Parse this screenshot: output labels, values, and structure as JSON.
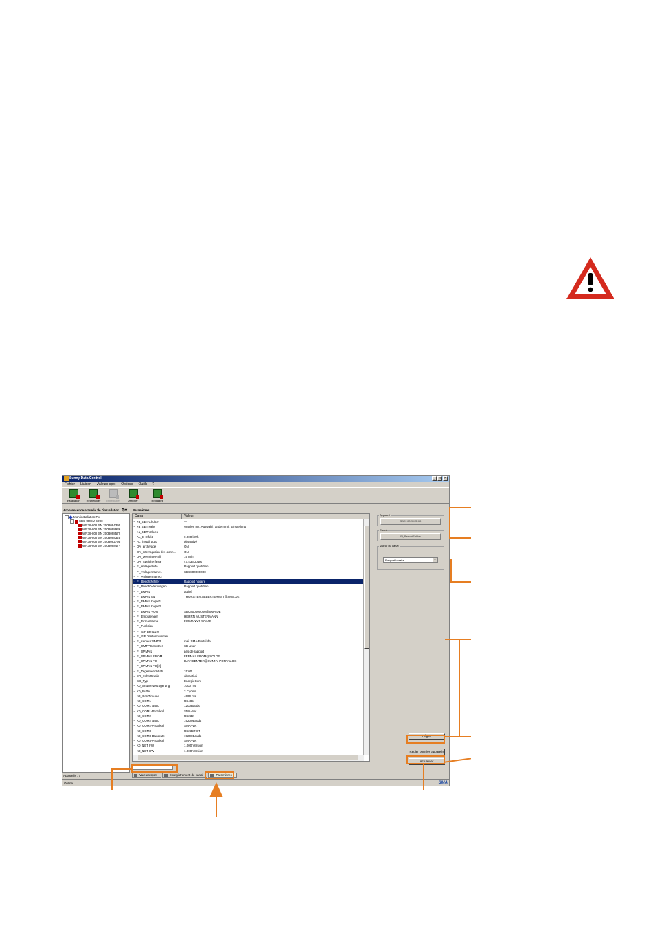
{
  "window": {
    "title": "Sunny Data Control",
    "controls": [
      "_",
      "□",
      "×"
    ]
  },
  "menu": [
    "Fichier",
    "Liaison",
    "Valeurs spot",
    "Options",
    "Outils",
    "?"
  ],
  "toolbar": [
    {
      "label": "Installation",
      "enabled": true
    },
    {
      "label": "Rechercher",
      "enabled": true
    },
    {
      "label": "Enregistrer",
      "enabled": false
    },
    {
      "label": "Afficher",
      "enabled": true
    },
    {
      "label": "Réglages",
      "enabled": true
    }
  ],
  "tree": {
    "header": "Arborescence actuelle de l'installation",
    "root": "Mon installation PV",
    "controller": "SBC+00EM SKI0",
    "devices": [
      "WR38-808 SN 2008094392",
      "WR38-808 SN 2008098939",
      "WR38-808 SN 2008098572",
      "WR38-808 SN 2008098325",
      "WR38-808 SN 2008092795",
      "WR38-808 SN 2008098477"
    ],
    "footer": "Appareils : 7"
  },
  "params": {
    "header": "Paramètres",
    "columns": [
      "Canal",
      "Valeur"
    ],
    "selected_index": 12,
    "rows": [
      [
        "+a_SET Choice",
        "---"
      ],
      [
        "+a_SET Help",
        "Wählen mit 'Auswahl', ändern mit 'Einstellung'"
      ],
      [
        "+a_SET Values",
        ""
      ],
      [
        "AL_E-Effekt",
        "0.000 kWh"
      ],
      [
        "AL_install auto",
        "désactivé"
      ],
      [
        "DA_archivage",
        "ON"
      ],
      [
        "DA_interrogation des donn...",
        "ON"
      ],
      [
        "DA_Messintervall",
        "15 min"
      ],
      [
        "DA_Speicherfeste",
        "47.436 Jours"
      ],
      [
        "FI_AnlagenInfo",
        "Rapport quotidien"
      ],
      [
        "FI_Anlagenname1",
        "SBC800000000"
      ],
      [
        "FI_Anlagenname2",
        ""
      ],
      [
        "FI_BerichtFehler",
        "Rapport horaire"
      ],
      [
        "FI_BerichtWarnungen",
        "Rapport quotidien"
      ],
      [
        "FI_EMAIL",
        "activé"
      ],
      [
        "FI_EMAIL AN",
        "THORSTEN.ALBERTERNST@SMA.DE"
      ],
      [
        "FI_EMAIL Kopie1",
        ""
      ],
      [
        "FI_EMAIL Kopie2",
        ""
      ],
      [
        "FI_EMAIL VON",
        "SBC800000000@SMA.DE"
      ],
      [
        "FI_Empfaenger",
        "HERRN MUSTERMANN"
      ],
      [
        "FI_Firma/Name",
        "FIRMA XYZ SOLAR"
      ],
      [
        "FI_Funktion",
        "---"
      ],
      [
        "FI_ISP Benutzer",
        ""
      ],
      [
        "FI_ISP Telefonnummer",
        ""
      ],
      [
        "FI_serveur SMTP",
        "mail.SMA-Portal.de"
      ],
      [
        "FI_SMTP Benutzer",
        "SB User"
      ],
      [
        "FI_SPMAIL",
        "pas de rapport"
      ],
      [
        "FI_SPMAIL FROM",
        "FEPMAILFROM@SOI.DE"
      ],
      [
        "FI_SPMAIL TO",
        "DATACENTER@SUNNY-PORTAL.DE"
      ],
      [
        "FI_SPMAIL TO[2]",
        ""
      ],
      [
        "FI_Tagesbericht ab",
        "15:00"
      ],
      [
        "SD_Schnittstelle",
        "désactivé"
      ],
      [
        "SD_Typ",
        "EnergieCom"
      ],
      [
        "K0_Antwortverzögerung",
        "1000 ms"
      ],
      [
        "K0_Buffer",
        "2 Cycles"
      ],
      [
        "K0_GrafTimeout",
        "4000 ms"
      ],
      [
        "K0_COM1",
        "RS485"
      ],
      [
        "K0_COM1 Baud",
        "1200Bauds"
      ],
      [
        "K0_COM1-Protokoll",
        "SMA-Net"
      ],
      [
        "K0_COM2",
        "RS232"
      ],
      [
        "K0_COM2 Baud",
        "19200Bauds"
      ],
      [
        "K0_COM2-Protokoll",
        "SMA-Net"
      ],
      [
        "K0_COM3",
        "RS232/NET"
      ],
      [
        "K0_COM3-Baudrate",
        "19200Bauds"
      ],
      [
        "K0_COM3-Protokoll",
        "SMA-Net"
      ],
      [
        "K0_NET FW",
        "1.000 Version"
      ],
      [
        "K0_NET HW",
        "1.000 Version"
      ]
    ]
  },
  "details": {
    "device_label": "Appareil",
    "device_value": "SBC+00EM SKI0",
    "channel_label": "Canal",
    "channel_value": "FI_BerichtFehler",
    "value_label": "Valeur du canal",
    "value_select": "Rapport horaire",
    "buttons": {
      "set": "Régler",
      "set_all": "Régler pour les appareils",
      "refresh": "Actualiser"
    }
  },
  "tabs": [
    "Valeurs spot",
    "Enregistrement de canal",
    "Paramètres"
  ],
  "status": {
    "left": "Online",
    "brand": "SMA"
  },
  "colors": {
    "accent": "#e67e22",
    "warning_red": "#d42a1e",
    "selection": "#0a246a"
  }
}
